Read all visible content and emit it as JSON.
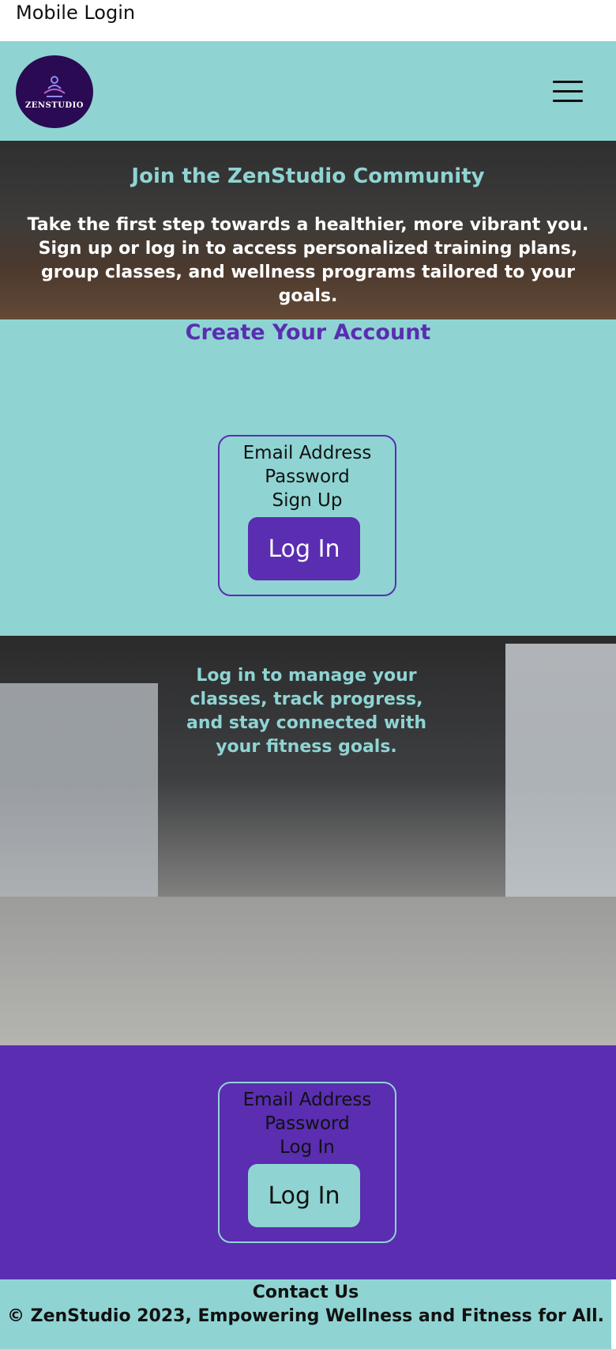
{
  "page": {
    "title": "Mobile Login"
  },
  "header": {
    "logo_text": "ZENSTUDIO",
    "menu_icon": "hamburger-icon"
  },
  "hero": {
    "title": "Join the ZenStudio Community",
    "text": "Take the first step towards a healthier, more vibrant you. Sign up or log in to access personalized training plans, group classes, and wellness programs tailored to your goals."
  },
  "signup": {
    "heading": "Create Your Account",
    "email_label": "Email Address",
    "password_label": "Password",
    "action_label": "Sign Up",
    "button_label": "Log In"
  },
  "promo": {
    "text": "Log in to manage your classes, track progress, and stay connected with your fitness goals."
  },
  "login": {
    "email_label": "Email Address",
    "password_label": "Password",
    "action_label": "Log In",
    "button_label": "Log In"
  },
  "footer": {
    "contact_label": "Contact Us",
    "copyright": "© ZenStudio 2023, Empowering Wellness and Fitness for All."
  },
  "colors": {
    "teal": "#8fd4d3",
    "purple": "#5a2db1",
    "logo_bg": "#2a0a52"
  }
}
